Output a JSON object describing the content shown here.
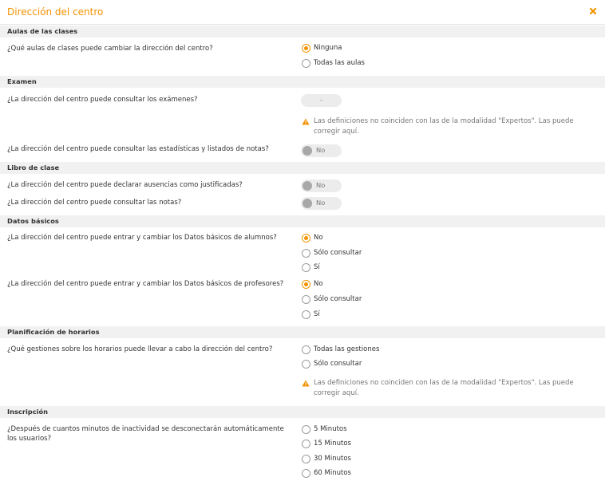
{
  "dialog": {
    "title": "Dirección del centro",
    "close_icon": "close-icon",
    "accent_color": "#f39200"
  },
  "sections": {
    "aulas": {
      "title": "Aulas de las clases",
      "q1": {
        "text": "¿Qué aulas de clases puede cambiar la dirección del centro?",
        "options": [
          "Ninguna",
          "Todas las aulas"
        ],
        "selected": "Ninguna"
      }
    },
    "examen": {
      "title": "Examen",
      "q1": {
        "text": "¿La dirección del centro puede consultar los exámenes?",
        "toggle": "-"
      },
      "warning": "Las definiciones no coinciden con las de la modalidad \"Expertos\". Las puede corregir aquí.",
      "q2": {
        "text": "¿La dirección del centro puede consultar las estadísticas y listados de notas?",
        "toggle": "No"
      }
    },
    "libro": {
      "title": "Libro de clase",
      "q1": {
        "text": "¿La dirección del centro puede declarar ausencias como justificadas?",
        "toggle": "No"
      },
      "q2": {
        "text": "¿La dirección del centro puede consultar las notas?",
        "toggle": "No"
      }
    },
    "datos": {
      "title": "Datos básicos",
      "q1": {
        "text": "¿La dirección del centro puede entrar y cambiar los Datos básicos de alumnos?",
        "options": [
          "No",
          "Sólo consultar",
          "Sí"
        ],
        "selected": "No"
      },
      "q2": {
        "text": "¿La dirección del centro puede entrar y cambiar los Datos básicos de profesores?",
        "options": [
          "No",
          "Sólo consultar",
          "Sí"
        ],
        "selected": "No"
      }
    },
    "horarios": {
      "title": "Planificación de horarios",
      "q1": {
        "text": "¿Qué gestiones sobre los horarios puede llevar a cabo la dirección del centro?",
        "options": [
          "Todas las gestiones",
          "Sólo consultar"
        ],
        "selected": ""
      },
      "warning": "Las definiciones no coinciden con las de la modalidad \"Expertos\". Las puede corregir aquí."
    },
    "inscripcion": {
      "title": "Inscripción",
      "q1": {
        "text": "¿Después de cuantos minutos de inactividad se desconectarán automáticamente los usuarios?",
        "options": [
          "5 Minutos",
          "15 Minutos",
          "30 Minutos",
          "60 Minutos"
        ],
        "selected": ""
      }
    }
  }
}
